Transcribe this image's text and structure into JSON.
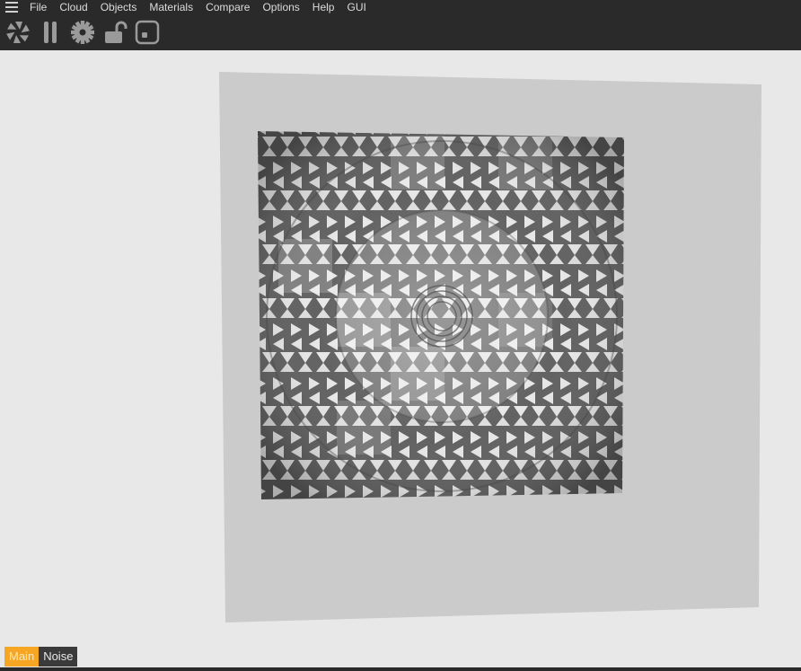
{
  "menubar": {
    "menu_icon": "hamburger-icon",
    "items": [
      {
        "label": "File"
      },
      {
        "label": "Cloud"
      },
      {
        "label": "Objects"
      },
      {
        "label": "Materials"
      },
      {
        "label": "Compare"
      },
      {
        "label": "Options"
      },
      {
        "label": "Help"
      },
      {
        "label": "GUI"
      }
    ]
  },
  "toolbar": {
    "tools": [
      {
        "name": "aperture-icon"
      },
      {
        "name": "pause-icon"
      },
      {
        "name": "gear-icon"
      },
      {
        "name": "unlock-icon"
      },
      {
        "name": "rounded-square-icon"
      }
    ]
  },
  "viewport": {
    "background": "#e8e8e8",
    "plane_color": "#cbcbcb",
    "texture_description_icon": "triangle-lattice-texture"
  },
  "tabs": {
    "items": [
      {
        "label": "Main",
        "active": true
      },
      {
        "label": "Noise",
        "active": false
      }
    ],
    "active_color": "#f6a623"
  }
}
